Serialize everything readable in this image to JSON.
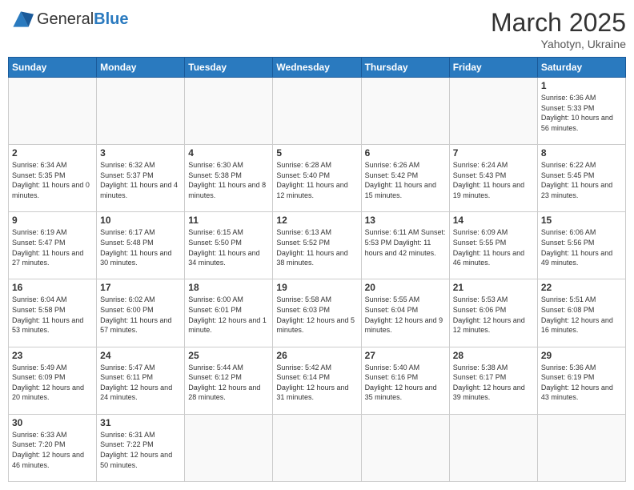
{
  "header": {
    "logo_general": "General",
    "logo_blue": "Blue",
    "month_title": "March 2025",
    "location": "Yahotyn, Ukraine"
  },
  "days_of_week": [
    "Sunday",
    "Monday",
    "Tuesday",
    "Wednesday",
    "Thursday",
    "Friday",
    "Saturday"
  ],
  "weeks": [
    [
      {
        "day": "",
        "info": ""
      },
      {
        "day": "",
        "info": ""
      },
      {
        "day": "",
        "info": ""
      },
      {
        "day": "",
        "info": ""
      },
      {
        "day": "",
        "info": ""
      },
      {
        "day": "",
        "info": ""
      },
      {
        "day": "1",
        "info": "Sunrise: 6:36 AM\nSunset: 5:33 PM\nDaylight: 10 hours\nand 56 minutes."
      }
    ],
    [
      {
        "day": "2",
        "info": "Sunrise: 6:34 AM\nSunset: 5:35 PM\nDaylight: 11 hours\nand 0 minutes."
      },
      {
        "day": "3",
        "info": "Sunrise: 6:32 AM\nSunset: 5:37 PM\nDaylight: 11 hours\nand 4 minutes."
      },
      {
        "day": "4",
        "info": "Sunrise: 6:30 AM\nSunset: 5:38 PM\nDaylight: 11 hours\nand 8 minutes."
      },
      {
        "day": "5",
        "info": "Sunrise: 6:28 AM\nSunset: 5:40 PM\nDaylight: 11 hours\nand 12 minutes."
      },
      {
        "day": "6",
        "info": "Sunrise: 6:26 AM\nSunset: 5:42 PM\nDaylight: 11 hours\nand 15 minutes."
      },
      {
        "day": "7",
        "info": "Sunrise: 6:24 AM\nSunset: 5:43 PM\nDaylight: 11 hours\nand 19 minutes."
      },
      {
        "day": "8",
        "info": "Sunrise: 6:22 AM\nSunset: 5:45 PM\nDaylight: 11 hours\nand 23 minutes."
      }
    ],
    [
      {
        "day": "9",
        "info": "Sunrise: 6:19 AM\nSunset: 5:47 PM\nDaylight: 11 hours\nand 27 minutes."
      },
      {
        "day": "10",
        "info": "Sunrise: 6:17 AM\nSunset: 5:48 PM\nDaylight: 11 hours\nand 30 minutes."
      },
      {
        "day": "11",
        "info": "Sunrise: 6:15 AM\nSunset: 5:50 PM\nDaylight: 11 hours\nand 34 minutes."
      },
      {
        "day": "12",
        "info": "Sunrise: 6:13 AM\nSunset: 5:52 PM\nDaylight: 11 hours\nand 38 minutes."
      },
      {
        "day": "13",
        "info": "Sunrise: 6:11 AM\nSunset: 5:53 PM\nDaylight: 11 hours\nand 42 minutes."
      },
      {
        "day": "14",
        "info": "Sunrise: 6:09 AM\nSunset: 5:55 PM\nDaylight: 11 hours\nand 46 minutes."
      },
      {
        "day": "15",
        "info": "Sunrise: 6:06 AM\nSunset: 5:56 PM\nDaylight: 11 hours\nand 49 minutes."
      }
    ],
    [
      {
        "day": "16",
        "info": "Sunrise: 6:04 AM\nSunset: 5:58 PM\nDaylight: 11 hours\nand 53 minutes."
      },
      {
        "day": "17",
        "info": "Sunrise: 6:02 AM\nSunset: 6:00 PM\nDaylight: 11 hours\nand 57 minutes."
      },
      {
        "day": "18",
        "info": "Sunrise: 6:00 AM\nSunset: 6:01 PM\nDaylight: 12 hours\nand 1 minute."
      },
      {
        "day": "19",
        "info": "Sunrise: 5:58 AM\nSunset: 6:03 PM\nDaylight: 12 hours\nand 5 minutes."
      },
      {
        "day": "20",
        "info": "Sunrise: 5:55 AM\nSunset: 6:04 PM\nDaylight: 12 hours\nand 9 minutes."
      },
      {
        "day": "21",
        "info": "Sunrise: 5:53 AM\nSunset: 6:06 PM\nDaylight: 12 hours\nand 12 minutes."
      },
      {
        "day": "22",
        "info": "Sunrise: 5:51 AM\nSunset: 6:08 PM\nDaylight: 12 hours\nand 16 minutes."
      }
    ],
    [
      {
        "day": "23",
        "info": "Sunrise: 5:49 AM\nSunset: 6:09 PM\nDaylight: 12 hours\nand 20 minutes."
      },
      {
        "day": "24",
        "info": "Sunrise: 5:47 AM\nSunset: 6:11 PM\nDaylight: 12 hours\nand 24 minutes."
      },
      {
        "day": "25",
        "info": "Sunrise: 5:44 AM\nSunset: 6:12 PM\nDaylight: 12 hours\nand 28 minutes."
      },
      {
        "day": "26",
        "info": "Sunrise: 5:42 AM\nSunset: 6:14 PM\nDaylight: 12 hours\nand 31 minutes."
      },
      {
        "day": "27",
        "info": "Sunrise: 5:40 AM\nSunset: 6:16 PM\nDaylight: 12 hours\nand 35 minutes."
      },
      {
        "day": "28",
        "info": "Sunrise: 5:38 AM\nSunset: 6:17 PM\nDaylight: 12 hours\nand 39 minutes."
      },
      {
        "day": "29",
        "info": "Sunrise: 5:36 AM\nSunset: 6:19 PM\nDaylight: 12 hours\nand 43 minutes."
      }
    ],
    [
      {
        "day": "30",
        "info": "Sunrise: 6:33 AM\nSunset: 7:20 PM\nDaylight: 12 hours\nand 46 minutes."
      },
      {
        "day": "31",
        "info": "Sunrise: 6:31 AM\nSunset: 7:22 PM\nDaylight: 12 hours\nand 50 minutes."
      },
      {
        "day": "",
        "info": ""
      },
      {
        "day": "",
        "info": ""
      },
      {
        "day": "",
        "info": ""
      },
      {
        "day": "",
        "info": ""
      },
      {
        "day": "",
        "info": ""
      }
    ]
  ]
}
